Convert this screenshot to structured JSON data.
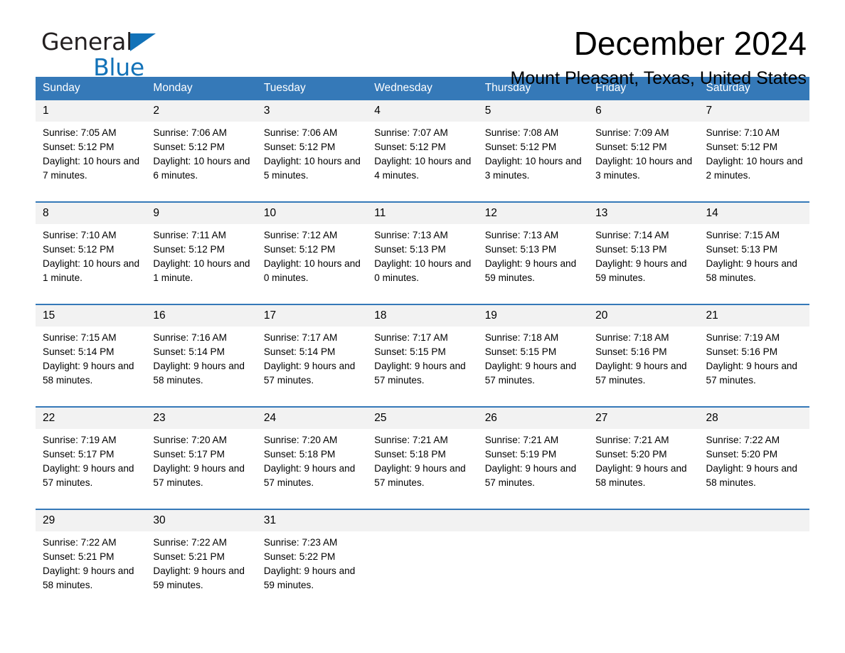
{
  "brand": {
    "name_part1": "General",
    "name_part2": "Blue",
    "color_blue": "#1272b8"
  },
  "header": {
    "title": "December 2024",
    "location": "Mount Pleasant, Texas, United States"
  },
  "theme": {
    "header_blue": "#3579b8",
    "day_band_gray": "#f2f2f2"
  },
  "weekdays": [
    "Sunday",
    "Monday",
    "Tuesday",
    "Wednesday",
    "Thursday",
    "Friday",
    "Saturday"
  ],
  "days": [
    {
      "date": "1",
      "sunrise": "Sunrise: 7:05 AM",
      "sunset": "Sunset: 5:12 PM",
      "daylight": "Daylight: 10 hours and 7 minutes."
    },
    {
      "date": "2",
      "sunrise": "Sunrise: 7:06 AM",
      "sunset": "Sunset: 5:12 PM",
      "daylight": "Daylight: 10 hours and 6 minutes."
    },
    {
      "date": "3",
      "sunrise": "Sunrise: 7:06 AM",
      "sunset": "Sunset: 5:12 PM",
      "daylight": "Daylight: 10 hours and 5 minutes."
    },
    {
      "date": "4",
      "sunrise": "Sunrise: 7:07 AM",
      "sunset": "Sunset: 5:12 PM",
      "daylight": "Daylight: 10 hours and 4 minutes."
    },
    {
      "date": "5",
      "sunrise": "Sunrise: 7:08 AM",
      "sunset": "Sunset: 5:12 PM",
      "daylight": "Daylight: 10 hours and 3 minutes."
    },
    {
      "date": "6",
      "sunrise": "Sunrise: 7:09 AM",
      "sunset": "Sunset: 5:12 PM",
      "daylight": "Daylight: 10 hours and 3 minutes."
    },
    {
      "date": "7",
      "sunrise": "Sunrise: 7:10 AM",
      "sunset": "Sunset: 5:12 PM",
      "daylight": "Daylight: 10 hours and 2 minutes."
    },
    {
      "date": "8",
      "sunrise": "Sunrise: 7:10 AM",
      "sunset": "Sunset: 5:12 PM",
      "daylight": "Daylight: 10 hours and 1 minute."
    },
    {
      "date": "9",
      "sunrise": "Sunrise: 7:11 AM",
      "sunset": "Sunset: 5:12 PM",
      "daylight": "Daylight: 10 hours and 1 minute."
    },
    {
      "date": "10",
      "sunrise": "Sunrise: 7:12 AM",
      "sunset": "Sunset: 5:12 PM",
      "daylight": "Daylight: 10 hours and 0 minutes."
    },
    {
      "date": "11",
      "sunrise": "Sunrise: 7:13 AM",
      "sunset": "Sunset: 5:13 PM",
      "daylight": "Daylight: 10 hours and 0 minutes."
    },
    {
      "date": "12",
      "sunrise": "Sunrise: 7:13 AM",
      "sunset": "Sunset: 5:13 PM",
      "daylight": "Daylight: 9 hours and 59 minutes."
    },
    {
      "date": "13",
      "sunrise": "Sunrise: 7:14 AM",
      "sunset": "Sunset: 5:13 PM",
      "daylight": "Daylight: 9 hours and 59 minutes."
    },
    {
      "date": "14",
      "sunrise": "Sunrise: 7:15 AM",
      "sunset": "Sunset: 5:13 PM",
      "daylight": "Daylight: 9 hours and 58 minutes."
    },
    {
      "date": "15",
      "sunrise": "Sunrise: 7:15 AM",
      "sunset": "Sunset: 5:14 PM",
      "daylight": "Daylight: 9 hours and 58 minutes."
    },
    {
      "date": "16",
      "sunrise": "Sunrise: 7:16 AM",
      "sunset": "Sunset: 5:14 PM",
      "daylight": "Daylight: 9 hours and 58 minutes."
    },
    {
      "date": "17",
      "sunrise": "Sunrise: 7:17 AM",
      "sunset": "Sunset: 5:14 PM",
      "daylight": "Daylight: 9 hours and 57 minutes."
    },
    {
      "date": "18",
      "sunrise": "Sunrise: 7:17 AM",
      "sunset": "Sunset: 5:15 PM",
      "daylight": "Daylight: 9 hours and 57 minutes."
    },
    {
      "date": "19",
      "sunrise": "Sunrise: 7:18 AM",
      "sunset": "Sunset: 5:15 PM",
      "daylight": "Daylight: 9 hours and 57 minutes."
    },
    {
      "date": "20",
      "sunrise": "Sunrise: 7:18 AM",
      "sunset": "Sunset: 5:16 PM",
      "daylight": "Daylight: 9 hours and 57 minutes."
    },
    {
      "date": "21",
      "sunrise": "Sunrise: 7:19 AM",
      "sunset": "Sunset: 5:16 PM",
      "daylight": "Daylight: 9 hours and 57 minutes."
    },
    {
      "date": "22",
      "sunrise": "Sunrise: 7:19 AM",
      "sunset": "Sunset: 5:17 PM",
      "daylight": "Daylight: 9 hours and 57 minutes."
    },
    {
      "date": "23",
      "sunrise": "Sunrise: 7:20 AM",
      "sunset": "Sunset: 5:17 PM",
      "daylight": "Daylight: 9 hours and 57 minutes."
    },
    {
      "date": "24",
      "sunrise": "Sunrise: 7:20 AM",
      "sunset": "Sunset: 5:18 PM",
      "daylight": "Daylight: 9 hours and 57 minutes."
    },
    {
      "date": "25",
      "sunrise": "Sunrise: 7:21 AM",
      "sunset": "Sunset: 5:18 PM",
      "daylight": "Daylight: 9 hours and 57 minutes."
    },
    {
      "date": "26",
      "sunrise": "Sunrise: 7:21 AM",
      "sunset": "Sunset: 5:19 PM",
      "daylight": "Daylight: 9 hours and 57 minutes."
    },
    {
      "date": "27",
      "sunrise": "Sunrise: 7:21 AM",
      "sunset": "Sunset: 5:20 PM",
      "daylight": "Daylight: 9 hours and 58 minutes."
    },
    {
      "date": "28",
      "sunrise": "Sunrise: 7:22 AM",
      "sunset": "Sunset: 5:20 PM",
      "daylight": "Daylight: 9 hours and 58 minutes."
    },
    {
      "date": "29",
      "sunrise": "Sunrise: 7:22 AM",
      "sunset": "Sunset: 5:21 PM",
      "daylight": "Daylight: 9 hours and 58 minutes."
    },
    {
      "date": "30",
      "sunrise": "Sunrise: 7:22 AM",
      "sunset": "Sunset: 5:21 PM",
      "daylight": "Daylight: 9 hours and 59 minutes."
    },
    {
      "date": "31",
      "sunrise": "Sunrise: 7:23 AM",
      "sunset": "Sunset: 5:22 PM",
      "daylight": "Daylight: 9 hours and 59 minutes."
    }
  ],
  "grid": {
    "leading_blanks": 0,
    "trailing_blanks": 4
  }
}
